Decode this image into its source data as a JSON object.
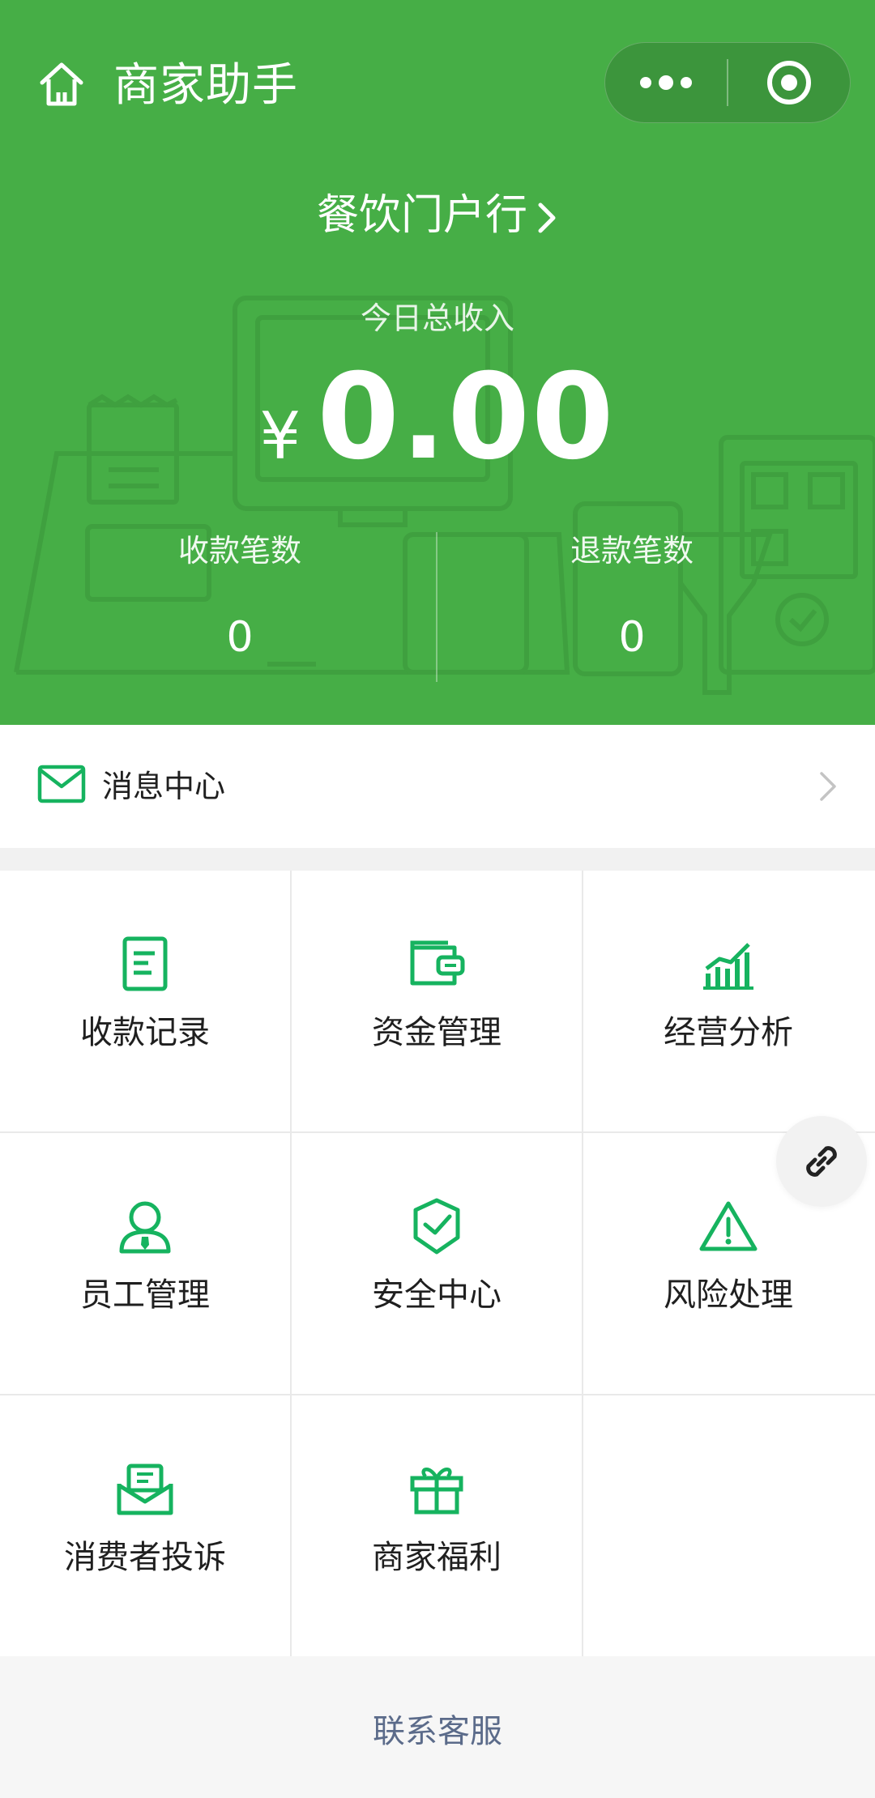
{
  "colors": {
    "brand_green": "#46ae46",
    "icon_green": "#16b35f",
    "link_blue_gray": "#5b6b8a"
  },
  "header": {
    "title": "商家助手",
    "home_icon": "home-icon",
    "more_icon": "more-dots-icon",
    "close_icon": "target-close-icon"
  },
  "store": {
    "name": "餐饮门户行",
    "chevron_icon": "chevron-right-icon"
  },
  "income": {
    "label": "今日总收入",
    "currency": "¥",
    "value": "0.00"
  },
  "stats": {
    "payments_label": "收款笔数",
    "payments_value": "0",
    "refunds_label": "退款笔数",
    "refunds_value": "0"
  },
  "message_center": {
    "icon": "envelope-icon",
    "label": "消息中心",
    "chevron_icon": "chevron-right-icon"
  },
  "grid": {
    "items": [
      {
        "label": "收款记录",
        "icon": "receipt-icon"
      },
      {
        "label": "资金管理",
        "icon": "wallet-icon"
      },
      {
        "label": "经营分析",
        "icon": "bar-chart-icon"
      },
      {
        "label": "员工管理",
        "icon": "staff-icon"
      },
      {
        "label": "安全中心",
        "icon": "shield-icon"
      },
      {
        "label": "风险处理",
        "icon": "warning-icon"
      },
      {
        "label": "消费者投诉",
        "icon": "mail-complaint-icon"
      },
      {
        "label": "商家福利",
        "icon": "gift-icon"
      }
    ]
  },
  "floating": {
    "icon": "link-icon"
  },
  "footer": {
    "contact_label": "联系客服"
  }
}
